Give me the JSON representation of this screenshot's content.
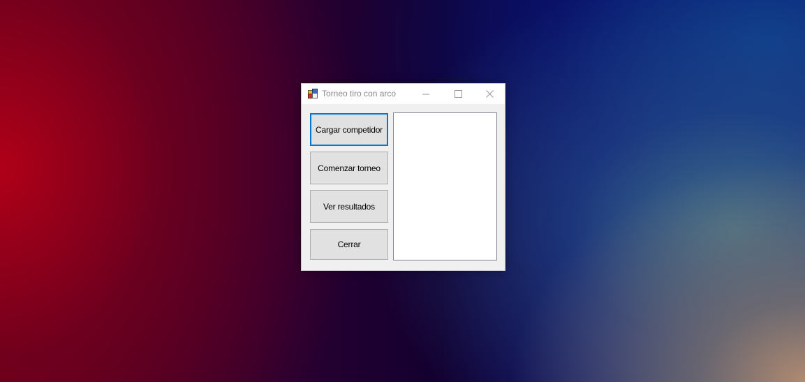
{
  "window": {
    "title": "Torneo tiro con arco",
    "icon": "app-icon",
    "controls": {
      "minimize_icon": "minimize-icon",
      "maximize_icon": "maximize-icon",
      "close_icon": "close-icon"
    }
  },
  "buttons": {
    "cargar": "Cargar competidor",
    "comenzar": "Comenzar torneo",
    "ver": "Ver resultados",
    "cerrar": "Cerrar"
  },
  "listbox": {
    "items": []
  },
  "colors": {
    "focus_border": "#0078d7",
    "button_bg": "#e1e1e1",
    "window_bg": "#f0f0f0"
  }
}
